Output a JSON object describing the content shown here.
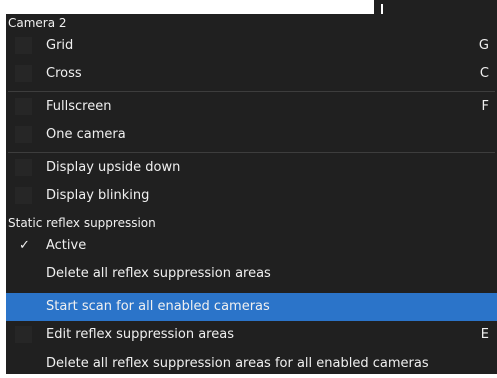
{
  "menu": {
    "sections": [
      {
        "header": "Camera 2",
        "items": [
          {
            "label": "Grid",
            "shortcut": "G"
          },
          {
            "label": "Cross",
            "shortcut": "C"
          },
          {
            "label": "Fullscreen",
            "shortcut": "F"
          },
          {
            "label": "One camera",
            "shortcut": ""
          },
          {
            "label": "Display upside down",
            "shortcut": ""
          },
          {
            "label": "Display blinking",
            "shortcut": ""
          }
        ]
      },
      {
        "header": "Static reflex suppression",
        "items": [
          {
            "label": "Active",
            "shortcut": "",
            "checked": true,
            "check_glyph": "✓"
          },
          {
            "label": "Delete all reflex suppression areas",
            "shortcut": ""
          },
          {
            "label": "Start scan for all enabled cameras",
            "shortcut": "",
            "highlighted": true
          },
          {
            "label": "Edit reflex suppression areas",
            "shortcut": "E"
          },
          {
            "label": "Delete all reflex suppression areas for all enabled cameras",
            "shortcut": ""
          }
        ]
      }
    ]
  },
  "colors": {
    "background": "#202020",
    "highlight": "#2b74c9",
    "text": "#f0f0f0",
    "checkbox": "#262626",
    "separator": "#3d3d3d"
  }
}
